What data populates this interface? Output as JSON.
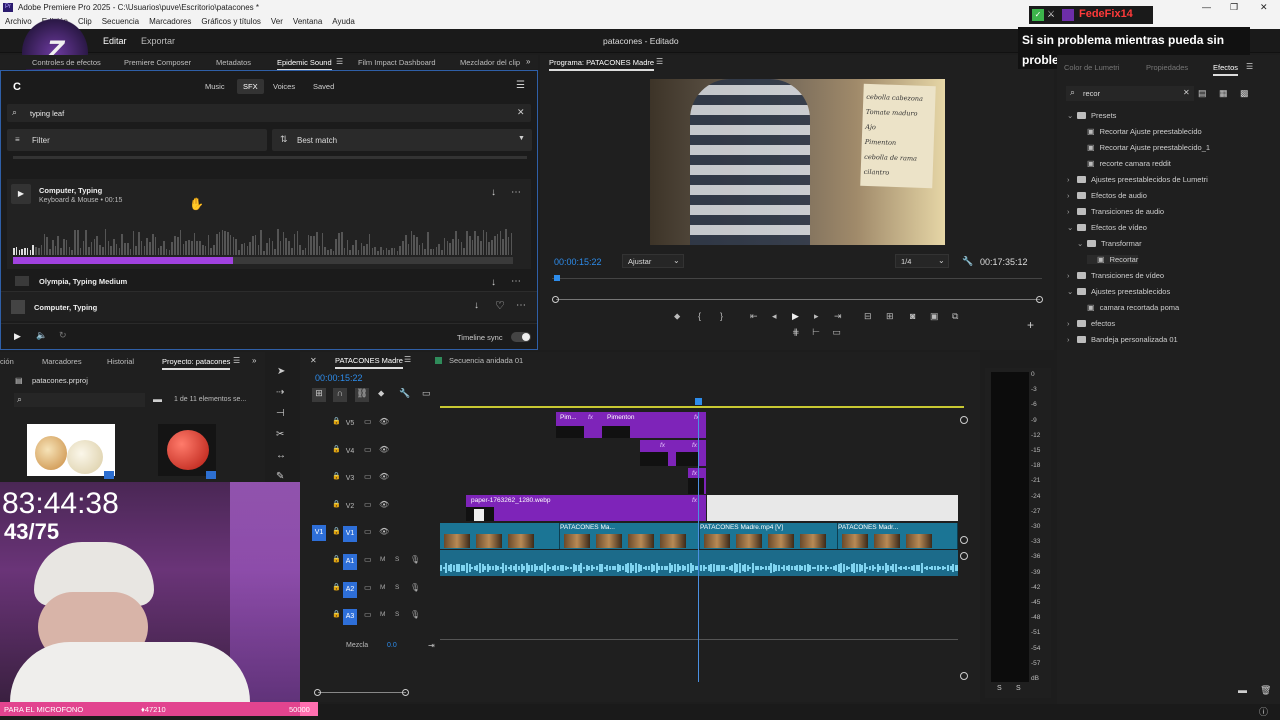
{
  "window": {
    "title": "Adobe Premiere Pro 2025 - C:\\Usuarios\\puve\\Escritorio\\patacones *"
  },
  "menu": [
    "Archivo",
    "Edición",
    "Clip",
    "Secuencia",
    "Marcadores",
    "Gráficos y títulos",
    "Ver",
    "Ventana",
    "Ayuda"
  ],
  "appbar": {
    "editar": "Editar",
    "exportar": "Exportar",
    "project_name": "patacones - Editado"
  },
  "overlay": {
    "streamer": "FedeFix14",
    "message": "Si sin problema mientras pueda sin problema",
    "timer": "83:44:38",
    "count": "43/75",
    "mic_label": "PARA EL MICROFONO",
    "bits_progress": "47210",
    "bits_goal": "50000",
    "bits_fraction": 0.944
  },
  "top_tabs": [
    "Controles de efectos",
    "Premiere Composer",
    "Metadatos",
    "Epidemic Sound",
    "Film Impact Dashboard",
    "Mezclador del clip"
  ],
  "epidemic": {
    "nav": [
      "Music",
      "SFX",
      "Voices",
      "Saved"
    ],
    "active_nav": "SFX",
    "search_value": "typing leaf",
    "filter_label": "Filter",
    "sort_label": "Best match",
    "results": [
      {
        "title": "Computer, Typing",
        "subtitle": "Keyboard & Mouse",
        "duration": "00:15"
      },
      {
        "title": "Olympia, Typing Medium"
      }
    ],
    "progress": 0.44,
    "now_playing": "Computer, Typing",
    "timeline_sync": "Timeline sync"
  },
  "program": {
    "title": "Programa: PATACONES Madre",
    "timecode": "00:00:15:22",
    "fit": "Ajustar",
    "quality": "1/4",
    "duration": "00:17:35:12",
    "note_lines": [
      "cebolla cabezona",
      "Tomate maduro",
      "Ajo",
      "Pimenton",
      "cebolla de rama",
      "cilantro"
    ]
  },
  "right": {
    "tabs": [
      "Color de Lumetri",
      "Propiedades",
      "Efectos"
    ],
    "active_tab": "Efectos",
    "search": "recor",
    "tree": [
      {
        "label": "Presets",
        "level": 0,
        "open": true
      },
      {
        "label": "Recortar Ajuste preestablecido",
        "level": 1,
        "item": true
      },
      {
        "label": "Recortar Ajuste preestablecido_1",
        "level": 1,
        "item": true
      },
      {
        "label": "recorte camara reddit",
        "level": 1,
        "item": true
      },
      {
        "label": "Ajustes preestablecidos de Lumetri",
        "level": 0,
        "open": false
      },
      {
        "label": "Efectos de audio",
        "level": 0,
        "open": false
      },
      {
        "label": "Transiciones de audio",
        "level": 0,
        "open": false
      },
      {
        "label": "Efectos de vídeo",
        "level": 0,
        "open": true
      },
      {
        "label": "Transformar",
        "level": 1,
        "open": true
      },
      {
        "label": "Recortar",
        "level": 2,
        "item": true,
        "selected": true
      },
      {
        "label": "Transiciones de vídeo",
        "level": 0,
        "open": false
      },
      {
        "label": "Ajustes preestablecidos",
        "level": 0,
        "open": true
      },
      {
        "label": "camara recortada poma",
        "level": 1,
        "item": true
      },
      {
        "label": "efectos",
        "level": 0,
        "open": false
      },
      {
        "label": "Bandeja personalizada 01",
        "level": 0,
        "open": false
      }
    ]
  },
  "project": {
    "tabs": [
      "ción",
      "Marcadores",
      "Historial",
      "Proyecto: patacones"
    ],
    "file": "patacones.prproj",
    "count": "1 de 11 elementos se..."
  },
  "timeline": {
    "tabs": [
      "PATACONES Madre",
      "Secuencia anidada 01"
    ],
    "timecode": "00:00:15:22",
    "video_tracks": [
      "V5",
      "V4",
      "V3",
      "V2",
      "V1"
    ],
    "audio_tracks": [
      "A1",
      "A2",
      "A3"
    ],
    "mix_label": "Mezcla",
    "mix_value": "0.0",
    "clips": {
      "pim": "Pim...",
      "pimenton": "Pimenton",
      "paper": "paper-1763262_1280.webp",
      "v1a": "PATACONES Ma...",
      "v1b": "PATACONES Madre.mp4 [V]",
      "v1c": "PATACONES Madr..."
    },
    "meter_scale": [
      "0",
      "-3",
      "-6",
      "-9",
      "-12",
      "-15",
      "-18",
      "-21",
      "-24",
      "-27",
      "-30",
      "-33",
      "-36",
      "-39",
      "-42",
      "-45",
      "-48",
      "-51",
      "-54",
      "-57",
      "dB"
    ]
  }
}
